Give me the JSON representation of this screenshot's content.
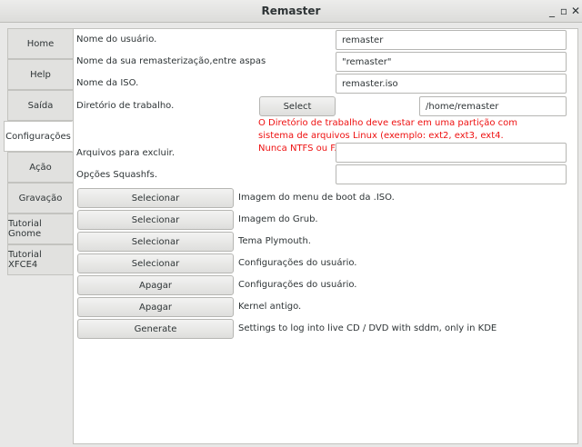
{
  "window": {
    "title": "Remaster",
    "minimize_glyph": "_",
    "maximize_glyph": "▫",
    "close_glyph": "✕"
  },
  "tabs": [
    {
      "label": "Home"
    },
    {
      "label": "Help"
    },
    {
      "label": "Saída"
    },
    {
      "label": "Configurações",
      "active": true
    },
    {
      "label": "Ação"
    },
    {
      "label": "Gravação"
    },
    {
      "label": "Tutorial Gnome"
    },
    {
      "label": "Tutorial XFCE4"
    }
  ],
  "form": {
    "username_label": "Nome do usuário.",
    "username_value": "remaster",
    "remaster_name_label": "Nome da sua remasterização,entre aspas",
    "remaster_name_value": "\"remaster\"",
    "iso_name_label": "Nome da ISO.",
    "iso_name_value": "remaster.iso",
    "workdir_label": "Diretório de trabalho.",
    "workdir_button": "Select",
    "workdir_value": "/home/remaster",
    "warning": "O Diretório de trabalho deve estar em uma partição com sistema de arquivos Linux (exemplo: ext2, ext3, ext4. Nunca NTFS ou FAT.).",
    "exclude_label": "Arquivos para excluir.",
    "exclude_value": "",
    "squashfs_label": "Opções Squashfs.",
    "squashfs_value": ""
  },
  "actions": [
    {
      "button": "Selecionar",
      "description": "Imagem do menu de boot da .ISO."
    },
    {
      "button": "Selecionar",
      "description": "Imagem do Grub."
    },
    {
      "button": "Selecionar",
      "description": "Tema Plymouth."
    },
    {
      "button": "Selecionar",
      "description": "Configurações do usuário."
    },
    {
      "button": "Apagar",
      "description": "Configurações do usuário."
    },
    {
      "button": "Apagar",
      "description": "Kernel antigo."
    },
    {
      "button": "Generate",
      "description": "Settings to log into live CD / DVD with sddm, only in KDE"
    }
  ],
  "colors": {
    "warning": "#ee1111",
    "background": "#e8e8e7",
    "panel": "#ffffff"
  }
}
